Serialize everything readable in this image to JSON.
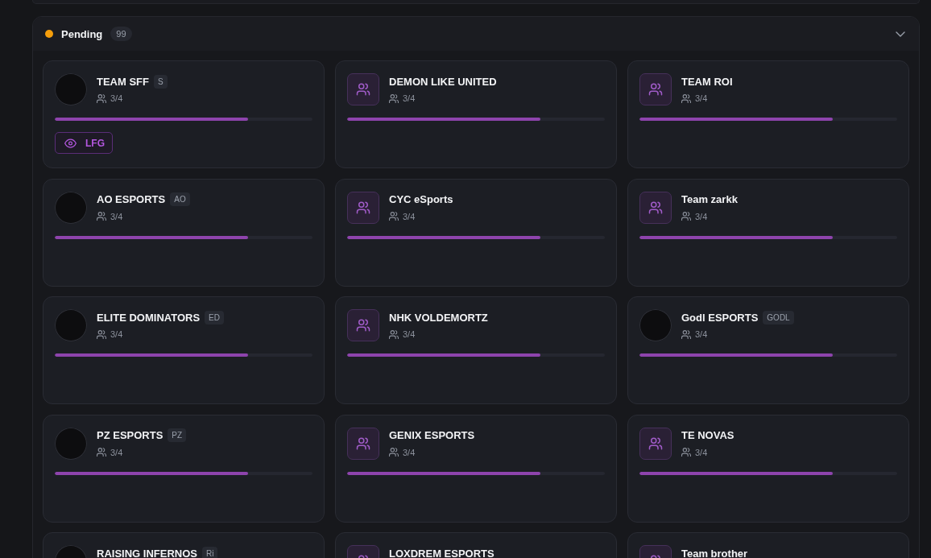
{
  "section": {
    "title": "Pending",
    "count": "99",
    "color": "#f59e0b",
    "expanded": true
  },
  "teams": [
    {
      "name": "TEAM SFF",
      "tag": "S",
      "kind": "logo",
      "members": "3/4",
      "level": 0.75,
      "lfg": "LFG"
    },
    {
      "name": "DEMON LIKE UNITED",
      "kind": "placeholder",
      "members": "3/4",
      "level": 0.75
    },
    {
      "name": "TEAM ROI",
      "kind": "placeholder",
      "members": "3/4",
      "level": 0.75
    },
    {
      "name": "AO ESPORTS",
      "tag": "AO",
      "kind": "logo",
      "members": "3/4",
      "level": 0.75
    },
    {
      "name": "CYC eSports",
      "kind": "placeholder",
      "members": "3/4",
      "level": 0.75
    },
    {
      "name": "Team zarkk",
      "kind": "placeholder",
      "members": "3/4",
      "level": 0.75
    },
    {
      "name": "ELITE DOMINATORS",
      "tag": "ED",
      "kind": "logo",
      "members": "3/4",
      "level": 0.75
    },
    {
      "name": "NHK VOLDEMORTZ",
      "kind": "placeholder",
      "members": "3/4",
      "level": 0.75
    },
    {
      "name": "Godl ESPORTS",
      "tag": "GODL",
      "kind": "logo",
      "members": "3/4",
      "level": 0.75
    },
    {
      "name": "PZ ESPORTS",
      "tag": "PZ",
      "kind": "logo",
      "members": "3/4",
      "level": 0.75
    },
    {
      "name": "GENIX ESPORTS",
      "kind": "placeholder",
      "members": "3/4",
      "level": 0.75
    },
    {
      "name": "TE NOVAS",
      "kind": "placeholder",
      "members": "3/4",
      "level": 0.75
    },
    {
      "name": "RAISING INFERNOS",
      "tag": "Ri",
      "kind": "logo"
    },
    {
      "name": "LOXDREM ESPORTS",
      "kind": "placeholder"
    },
    {
      "name": "Team brother",
      "kind": "placeholder"
    }
  ]
}
